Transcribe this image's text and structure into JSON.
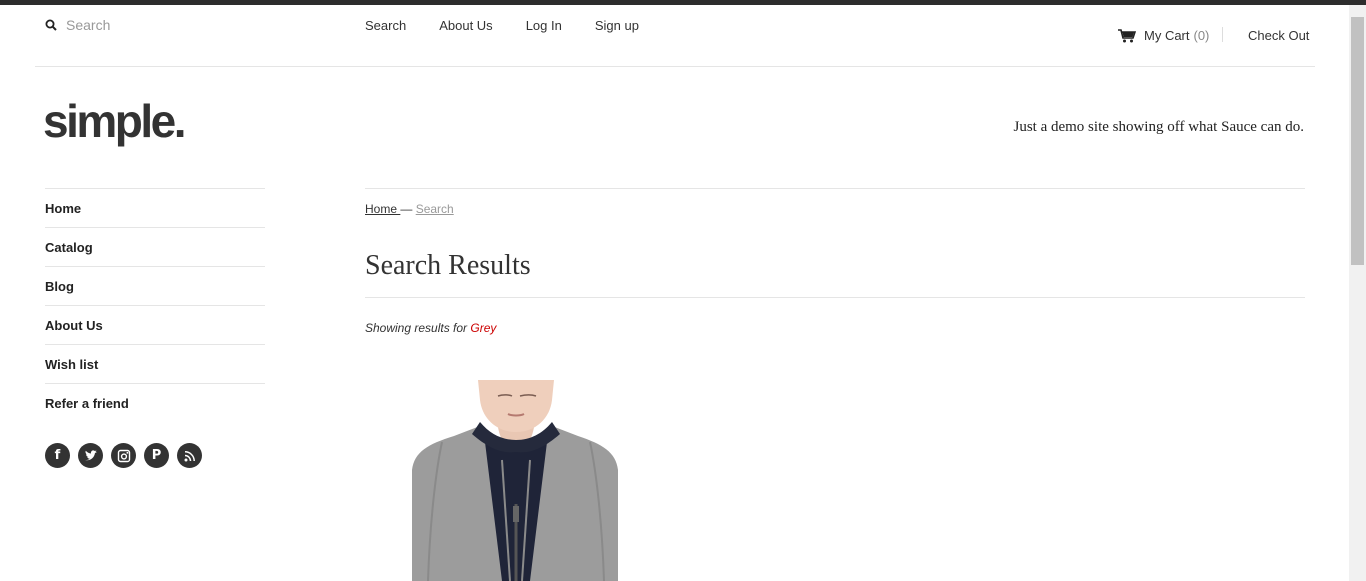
{
  "search": {
    "placeholder": "Search",
    "icon": "search-icon"
  },
  "top_nav": [
    "Search",
    "About Us",
    "Log In",
    "Sign up"
  ],
  "cart": {
    "label": "My Cart",
    "count": "(0)",
    "icon": "cart-icon"
  },
  "checkout_label": "Check Out",
  "logo_text": "simple.",
  "tagline": "Just a demo site showing off what Sauce can do.",
  "side_nav": [
    "Home",
    "Catalog",
    "Blog",
    "About Us",
    "Wish list",
    "Refer a friend"
  ],
  "social_icons": [
    "facebook-icon",
    "twitter-icon",
    "instagram-icon",
    "pinterest-icon",
    "rss-icon"
  ],
  "breadcrumb": {
    "home": "Home ",
    "separator": " — ",
    "current": "Search"
  },
  "page_title": "Search Results",
  "results": {
    "prefix": "Showing results for ",
    "term": "Grey"
  },
  "colors": {
    "accent_term": "#cc0000",
    "topbar": "#2d2d2d",
    "text": "#333333"
  }
}
